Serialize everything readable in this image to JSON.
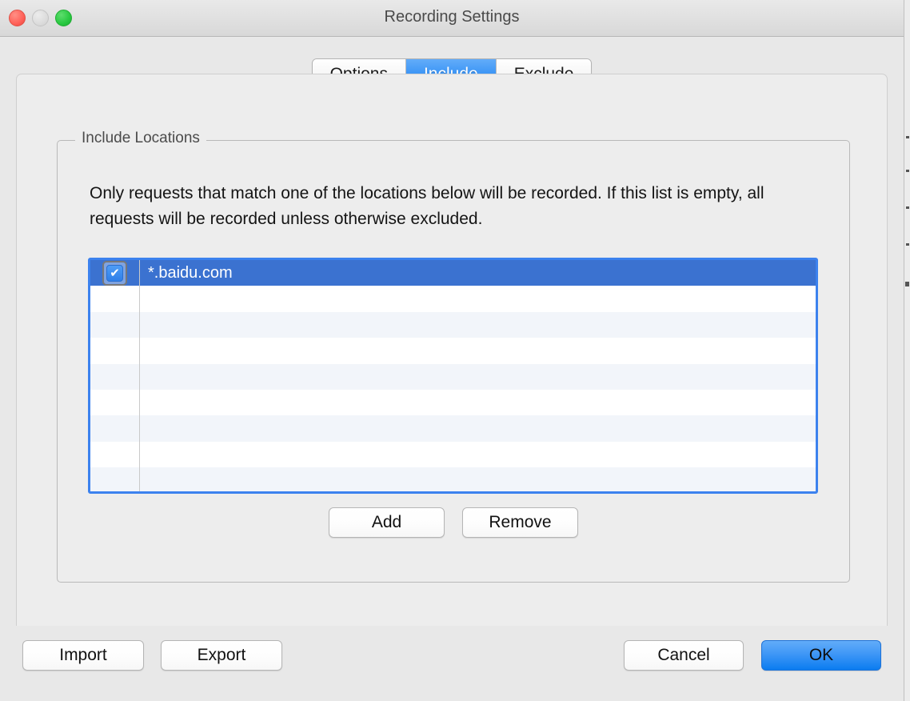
{
  "window": {
    "title": "Recording Settings",
    "traffic_lights": [
      {
        "name": "close",
        "color": "#FF6159"
      },
      {
        "name": "minimize",
        "color": "#D6D6D6"
      },
      {
        "name": "zoom",
        "color": "#28C840"
      }
    ]
  },
  "tabs": [
    {
      "label": "Options",
      "selected": false
    },
    {
      "label": "Include",
      "selected": true
    },
    {
      "label": "Exclude",
      "selected": false
    }
  ],
  "group": {
    "legend": "Include Locations",
    "description": "Only requests that match one of the locations below will be recorded. If this list is empty, all requests will be recorded unless otherwise excluded."
  },
  "table": {
    "rows": [
      {
        "checked": true,
        "location": "*.baidu.com",
        "selected": true
      },
      {
        "checked": false,
        "location": "",
        "selected": false
      },
      {
        "checked": false,
        "location": "",
        "selected": false
      },
      {
        "checked": false,
        "location": "",
        "selected": false
      },
      {
        "checked": false,
        "location": "",
        "selected": false
      },
      {
        "checked": false,
        "location": "",
        "selected": false
      },
      {
        "checked": false,
        "location": "",
        "selected": false
      },
      {
        "checked": false,
        "location": "",
        "selected": false
      },
      {
        "checked": false,
        "location": "",
        "selected": false
      }
    ],
    "checkmark_glyph": "✔"
  },
  "list_buttons": {
    "add": "Add",
    "remove": "Remove"
  },
  "bottom_buttons": {
    "import": "Import",
    "export": "Export",
    "cancel": "Cancel",
    "ok": "OK"
  },
  "colors": {
    "accent_blue": "#0D7CEF",
    "selection_blue": "#3B72D0",
    "focus_ring": "#3C82EE",
    "dialog_bg": "#E8E8E8",
    "panel_bg": "#EDEDED",
    "row_alt": "#F2F5FA"
  }
}
